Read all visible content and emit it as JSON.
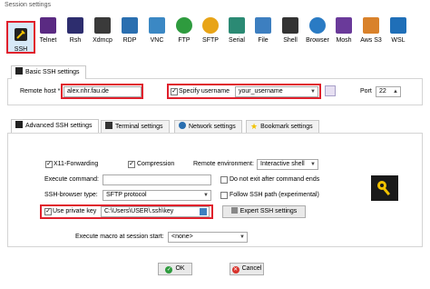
{
  "window": {
    "title": "Session settings"
  },
  "toolbar": {
    "items": [
      {
        "label": "SSH",
        "icon": "ssh-wrench-icon",
        "color": "#2b2b2b"
      },
      {
        "label": "Telnet",
        "icon": "telnet-icon",
        "color": "#5a2a82"
      },
      {
        "label": "Rsh",
        "icon": "rsh-icon",
        "color": "#2d2d6e"
      },
      {
        "label": "Xdmcp",
        "icon": "xdmcp-icon",
        "color": "#3a3a3a"
      },
      {
        "label": "RDP",
        "icon": "rdp-icon",
        "color": "#2a6fb0"
      },
      {
        "label": "VNC",
        "icon": "vnc-icon",
        "color": "#3b88c4"
      },
      {
        "label": "FTP",
        "icon": "ftp-icon",
        "color": "#2e9b3e"
      },
      {
        "label": "SFTP",
        "icon": "sftp-icon",
        "color": "#e8a417"
      },
      {
        "label": "Serial",
        "icon": "serial-icon",
        "color": "#2b8a74"
      },
      {
        "label": "File",
        "icon": "file-icon",
        "color": "#3d7fc0"
      },
      {
        "label": "Shell",
        "icon": "shell-icon",
        "color": "#333333"
      },
      {
        "label": "Browser",
        "icon": "browser-icon",
        "color": "#2a7bc4"
      },
      {
        "label": "Mosh",
        "icon": "mosh-icon",
        "color": "#6a3a9a"
      },
      {
        "label": "Aws S3",
        "icon": "aws-s3-icon",
        "color": "#d9822b"
      },
      {
        "label": "WSL",
        "icon": "wsl-icon",
        "color": "#1f6fb8"
      }
    ]
  },
  "basic": {
    "tab_label": "Basic SSH settings",
    "remote_host_label": "Remote host *",
    "remote_host_value": "alex.nhr.fau.de",
    "specify_username_label": "Specify username",
    "specify_username_checked": true,
    "username_value": "your_username",
    "port_label": "Port",
    "port_value": "22"
  },
  "advanced_tabs": [
    {
      "label": "Advanced SSH settings"
    },
    {
      "label": "Terminal settings"
    },
    {
      "label": "Network settings"
    },
    {
      "label": "Bookmark settings"
    }
  ],
  "advanced": {
    "x11_label": "X11-Forwarding",
    "x11_checked": true,
    "compression_label": "Compression",
    "compression_checked": true,
    "remote_env_label": "Remote environment:",
    "remote_env_value": "Interactive shell",
    "execute_command_label": "Execute command:",
    "execute_command_value": "",
    "do_not_exit_label": "Do not exit after command ends",
    "ssh_browser_label": "SSH-browser type:",
    "ssh_browser_value": "SFTP protocol",
    "follow_ssh_label": "Follow SSH path (experimental)",
    "use_private_key_label": "Use private key",
    "use_private_key_checked": true,
    "private_key_value": "C:\\Users\\USER\\.ssh\\key",
    "expert_button": "Expert SSH settings",
    "macro_label": "Execute macro at session start:",
    "macro_value": "<none>"
  },
  "buttons": {
    "ok": "OK",
    "cancel": "Cancel"
  },
  "colors": {
    "highlight_red": "#e0202c",
    "ok_green": "#2e9b3e",
    "cancel_red": "#d9332c",
    "key_yellow": "#f2c200"
  }
}
